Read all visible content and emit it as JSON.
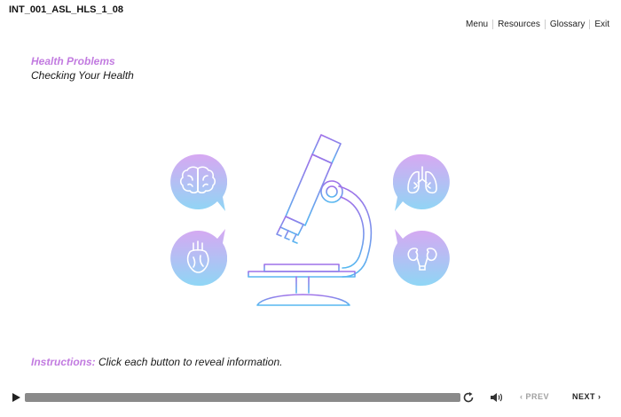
{
  "course_id": "INT_001_ASL_HLS_1_08",
  "nav": [
    "Menu",
    "Resources",
    "Glossary",
    "Exit"
  ],
  "module_title": "Health Problems",
  "slide_title": "Checking Your Health",
  "bubbles": [
    {
      "icon": "brain-icon"
    },
    {
      "icon": "lungs-icon"
    },
    {
      "icon": "heart-icon"
    },
    {
      "icon": "kidneys-icon"
    }
  ],
  "instructions": {
    "label": "Instructions:",
    "text": "Click each button to reveal information."
  },
  "player": {
    "prev_label": "‹ PREV",
    "next_label": "NEXT ›"
  },
  "colors": {
    "accent": "#c27be0",
    "gradient_start": "#d7a8f2",
    "gradient_end": "#8fd6f5",
    "microscope_line_start": "#a06fe8",
    "microscope_line_end": "#56b8f0"
  }
}
